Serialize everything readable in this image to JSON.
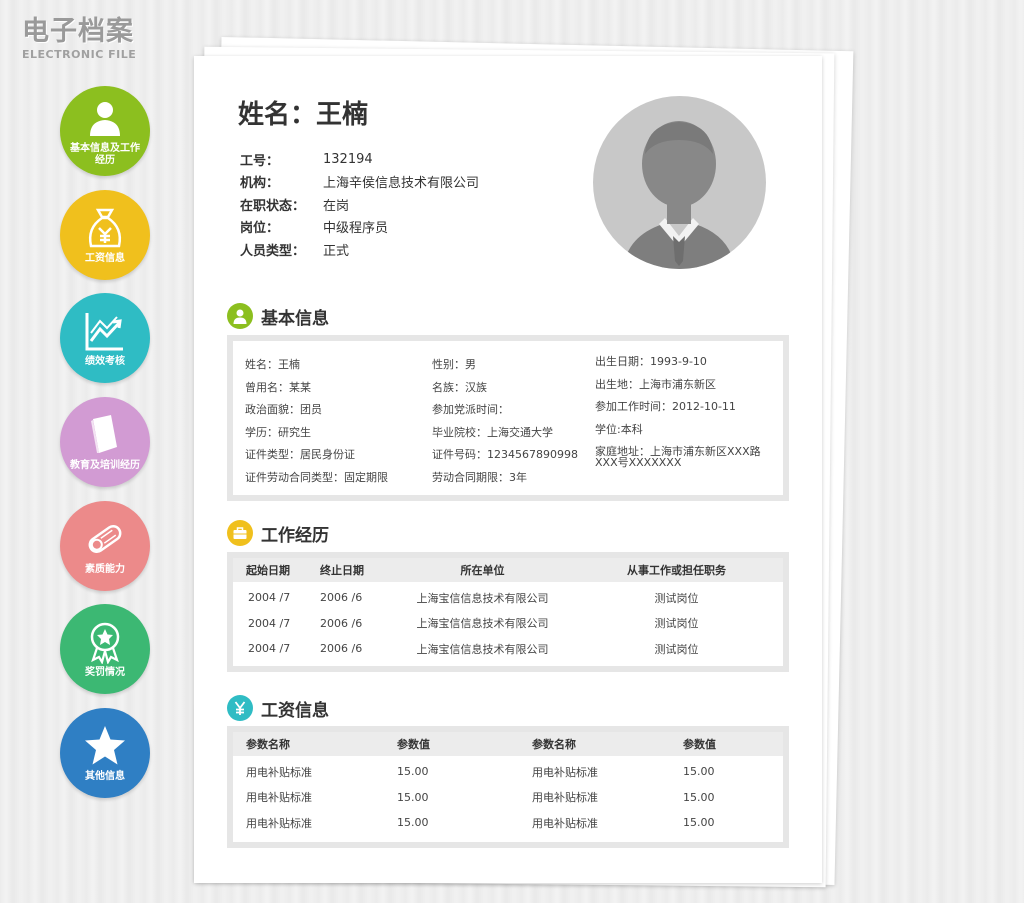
{
  "logo": {
    "cn": "电子档案",
    "en": "ELECTRONIC FILE"
  },
  "nav": [
    {
      "label": "基本信息及工作经历",
      "color": "#8cbf1f",
      "icon": "person-icon"
    },
    {
      "label": "工资信息",
      "color": "#f0c01d",
      "icon": "money-bag-icon"
    },
    {
      "label": "绩效考核",
      "color": "#2fbcc4",
      "icon": "trend-chart-icon"
    },
    {
      "label": "教育及培训经历",
      "color": "#d29bd3",
      "icon": "book-icon"
    },
    {
      "label": "素质能力",
      "color": "#ec8a8a",
      "icon": "diploma-icon"
    },
    {
      "label": "奖罚情况",
      "color": "#3cb873",
      "icon": "award-icon"
    },
    {
      "label": "其他信息",
      "color": "#2f7fc4",
      "icon": "star-icon"
    }
  ],
  "profile": {
    "name_title": "姓名：王楠",
    "fields": [
      {
        "label": "工号：",
        "value": "132194"
      },
      {
        "label": "机构：",
        "value": "上海辛侯信息技术有限公司"
      },
      {
        "label": "在职状态：",
        "value": "在岗"
      },
      {
        "label": "岗位：",
        "value": "中级程序员"
      },
      {
        "label": "人员类型：",
        "value": "正式"
      }
    ]
  },
  "basic": {
    "title": "基本信息",
    "rows": [
      [
        "姓名：王楠",
        "性别：男",
        "出生日期：1993-9-10"
      ],
      [
        "曾用名：某某",
        "名族：汉族",
        "出生地：上海市浦东新区"
      ],
      [
        "政治面貌：团员",
        "参加党派时间：",
        "参加工作时间：2012-10-11"
      ],
      [
        "学历：研究生",
        "毕业院校：上海交通大学",
        "学位:本科"
      ],
      [
        "证件类型：居民身份证",
        "证件号码：1234567890998",
        "家庭地址：上海市浦东新区XXX路XXX号XXXXXXX"
      ],
      [
        "证件劳动合同类型：固定期限",
        "劳动合同期限：3年",
        ""
      ]
    ]
  },
  "work": {
    "title": "工作经历",
    "headers": [
      "起始日期",
      "终止日期",
      "所在单位",
      "从事工作或担任职务"
    ],
    "rows": [
      [
        "2004 /7",
        "2006 /6",
        "上海宝信信息技术有限公司",
        "测试岗位"
      ],
      [
        "2004 /7",
        "2006 /6",
        "上海宝信信息技术有限公司",
        "测试岗位"
      ],
      [
        "2004 /7",
        "2006 /6",
        "上海宝信信息技术有限公司",
        "测试岗位"
      ]
    ]
  },
  "salary": {
    "title": "工资信息",
    "headers": [
      "参数名称",
      "参数值",
      "参数名称",
      "参数值"
    ],
    "rows": [
      [
        "用电补贴标准",
        "15.00",
        "用电补贴标准",
        "15.00"
      ],
      [
        "用电补贴标准",
        "15.00",
        "用电补贴标准",
        "15.00"
      ],
      [
        "用电补贴标准",
        "15.00",
        "用电补贴标准",
        "15.00"
      ]
    ]
  },
  "section_colors": {
    "basic": "#8cbf1f",
    "work": "#f0c01d",
    "salary": "#2fbcc4"
  }
}
